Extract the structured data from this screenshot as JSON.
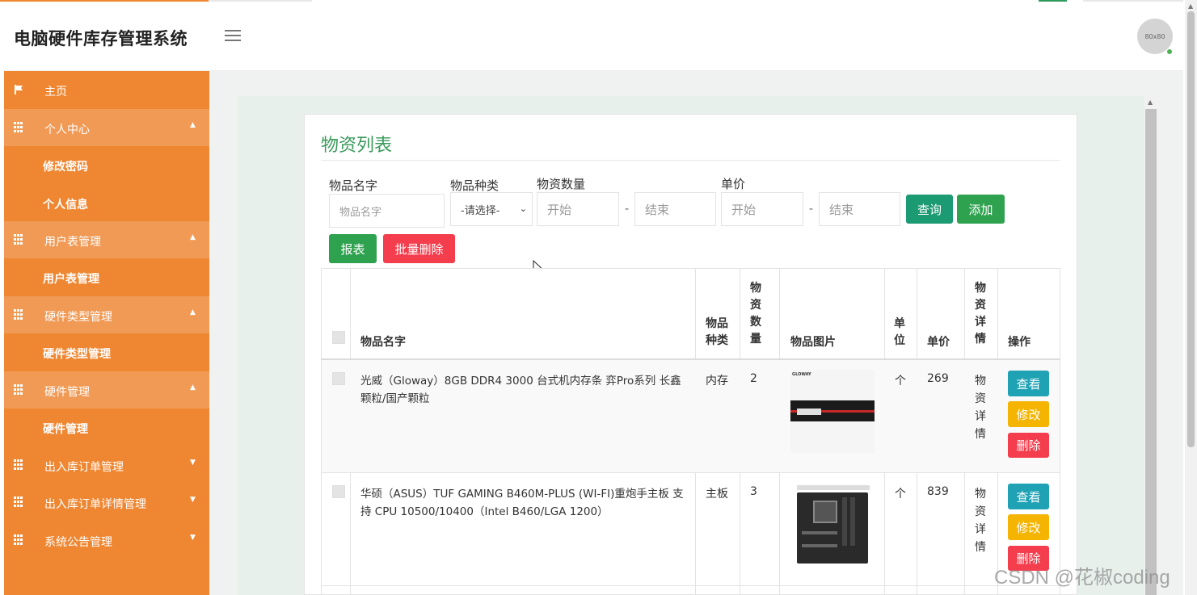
{
  "app": {
    "title": "电脑硬件库存管理系统",
    "avatar_text": "80x80"
  },
  "sidebar": {
    "items": [
      {
        "label": "主页",
        "icon": "flag-icon"
      },
      {
        "label": "个人中心",
        "icon": "grid-icon",
        "caret": "▲"
      },
      {
        "label": "修改密码"
      },
      {
        "label": "个人信息"
      },
      {
        "label": "用户表管理",
        "icon": "grid-icon",
        "caret": "▲"
      },
      {
        "label": "用户表管理"
      },
      {
        "label": "硬件类型管理",
        "icon": "grid-icon",
        "caret": "▲"
      },
      {
        "label": "硬件类型管理"
      },
      {
        "label": "硬件管理",
        "icon": "grid-icon",
        "caret": "▲"
      },
      {
        "label": "硬件管理"
      },
      {
        "label": "出入库订单管理",
        "icon": "grid-icon",
        "caret": "▼"
      },
      {
        "label": "出入库订单详情管理",
        "icon": "grid-icon",
        "caret": "▼"
      },
      {
        "label": "系统公告管理",
        "icon": "grid-icon",
        "caret": "▼"
      }
    ]
  },
  "panel": {
    "title": "物资列表"
  },
  "filters": {
    "name_label": "物品名字",
    "name_placeholder": "物品名字",
    "type_label": "物品种类",
    "type_selected": "-请选择-",
    "qty_label": "物资数量",
    "qty_start": "开始",
    "qty_end": "结束",
    "price_label": "单价",
    "price_start": "开始",
    "price_end": "结束",
    "dash": "-"
  },
  "buttons": {
    "query": "查询",
    "add": "添加",
    "report": "报表",
    "batch_delete": "批量删除"
  },
  "table": {
    "headers": {
      "name": "物品名字",
      "type": "物品种类",
      "qty": "物资数量",
      "image": "物品图片",
      "unit": "单位",
      "price": "单价",
      "detail": "物资详情",
      "ops": "操作"
    },
    "rows": [
      {
        "name": "光威（Gloway）8GB DDR4 3000 台式机内存条 弈Pro系列 长鑫颗粒/国产颗粒",
        "type": "内存",
        "qty": "2",
        "unit": "个",
        "price": "269",
        "detail": "物资详情",
        "view": "查看",
        "edit": "修改",
        "delete": "删除"
      },
      {
        "name": "华硕（ASUS）TUF GAMING B460M-PLUS (WI-FI)重炮手主板 支持 CPU 10500/10400（Intel B460/LGA 1200）",
        "type": "主板",
        "qty": "3",
        "unit": "个",
        "price": "839",
        "detail": "物资详情",
        "view": "查看",
        "edit": "修改",
        "delete": "删除"
      }
    ]
  },
  "watermark": "CSDN @花椒coding",
  "colors": {
    "sidebar": "#ef8732",
    "accent_green": "#3a9a5c",
    "btn_teal": "#1c9a72",
    "btn_red": "#f43d4d",
    "btn_info": "#1ea2b4",
    "btn_warn": "#f4b400"
  }
}
